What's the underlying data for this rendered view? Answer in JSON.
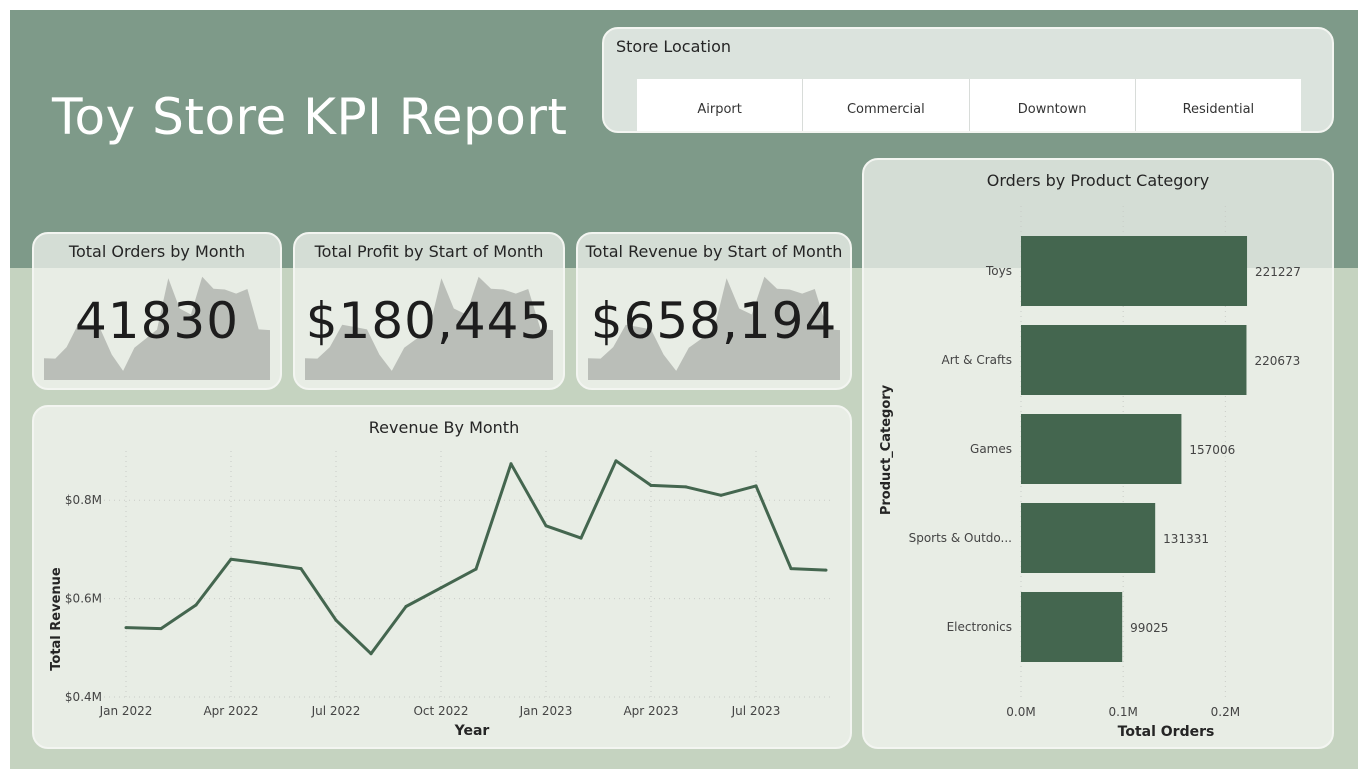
{
  "title": "Toy Store KPI Report",
  "slicer": {
    "title": "Store Location",
    "options": [
      "Airport",
      "Commercial",
      "Downtown",
      "Residential"
    ]
  },
  "kpis": [
    {
      "title": "Total Orders by Month",
      "value": "41830"
    },
    {
      "title": "Total Profit by Start of Month",
      "value": "$180,445"
    },
    {
      "title": "Total Revenue by Start of Month",
      "value": "$658,194"
    }
  ],
  "colors": {
    "background": "#c5d3c0",
    "header_band": "#7e9a89",
    "series": "#44664f",
    "sparkline_fill": "#b5b8b2"
  },
  "chart_data": [
    {
      "type": "area",
      "title": "Total Orders by Month",
      "x": [
        "Jan 2022",
        "Feb 2022",
        "Mar 2022",
        "Apr 2022",
        "May 2022",
        "Jun 2022",
        "Jul 2022",
        "Aug 2022",
        "Sep 2022",
        "Oct 2022",
        "Nov 2022",
        "Dec 2022",
        "Jan 2023",
        "Feb 2023",
        "Mar 2023",
        "Apr 2023",
        "May 2023",
        "Jun 2023",
        "Jul 2023",
        "Aug 2023",
        "Sep 2023"
      ],
      "values": [
        0.541,
        0.539,
        0.587,
        0.68,
        0.671,
        0.661,
        0.556,
        0.488,
        0.584,
        0.622,
        0.66,
        0.874,
        0.748,
        0.723,
        0.88,
        0.83,
        0.827,
        0.81,
        0.829,
        0.661,
        0.658
      ]
    },
    {
      "type": "area",
      "title": "Total Profit by Start of Month",
      "x": [
        "Jan 2022",
        "Feb 2022",
        "Mar 2022",
        "Apr 2022",
        "May 2022",
        "Jun 2022",
        "Jul 2022",
        "Aug 2022",
        "Sep 2022",
        "Oct 2022",
        "Nov 2022",
        "Dec 2022",
        "Jan 2023",
        "Feb 2023",
        "Mar 2023",
        "Apr 2023",
        "May 2023",
        "Jun 2023",
        "Jul 2023",
        "Aug 2023",
        "Sep 2023"
      ],
      "values": [
        0.541,
        0.539,
        0.587,
        0.68,
        0.671,
        0.661,
        0.556,
        0.488,
        0.584,
        0.622,
        0.66,
        0.874,
        0.748,
        0.723,
        0.88,
        0.83,
        0.827,
        0.81,
        0.829,
        0.661,
        0.658
      ]
    },
    {
      "type": "area",
      "title": "Total Revenue by Start of Month",
      "x": [
        "Jan 2022",
        "Feb 2022",
        "Mar 2022",
        "Apr 2022",
        "May 2022",
        "Jun 2022",
        "Jul 2022",
        "Aug 2022",
        "Sep 2022",
        "Oct 2022",
        "Nov 2022",
        "Dec 2022",
        "Jan 2023",
        "Feb 2023",
        "Mar 2023",
        "Apr 2023",
        "May 2023",
        "Jun 2023",
        "Jul 2023",
        "Aug 2023",
        "Sep 2023"
      ],
      "values": [
        0.541,
        0.539,
        0.587,
        0.68,
        0.671,
        0.661,
        0.556,
        0.488,
        0.584,
        0.622,
        0.66,
        0.874,
        0.748,
        0.723,
        0.88,
        0.83,
        0.827,
        0.81,
        0.829,
        0.661,
        0.658
      ]
    },
    {
      "type": "line",
      "title": "Revenue By Month",
      "xlabel": "Year",
      "ylabel": "Total Revenue",
      "x": [
        "Jan 2022",
        "Feb 2022",
        "Mar 2022",
        "Apr 2022",
        "May 2022",
        "Jun 2022",
        "Jul 2022",
        "Aug 2022",
        "Sep 2022",
        "Oct 2022",
        "Nov 2022",
        "Dec 2022",
        "Jan 2023",
        "Feb 2023",
        "Mar 2023",
        "Apr 2023",
        "May 2023",
        "Jun 2023",
        "Jul 2023",
        "Aug 2023",
        "Sep 2023"
      ],
      "series": [
        {
          "values": [
            0.541,
            0.539,
            0.587,
            0.68,
            0.671,
            0.661,
            0.556,
            0.488,
            0.584,
            0.622,
            0.66,
            0.874,
            0.748,
            0.723,
            0.88,
            0.83,
            0.827,
            0.81,
            0.829,
            0.661,
            0.658
          ]
        }
      ],
      "xticks": [
        "Jan 2022",
        "Apr 2022",
        "Jul 2022",
        "Oct 2022",
        "Jan 2023",
        "Apr 2023",
        "Jul 2023"
      ],
      "ytick_values": [
        0.4,
        0.6,
        0.8
      ],
      "ytick_labels": [
        "$0.4M",
        "$0.6M",
        "$0.8M"
      ],
      "ylim": [
        0.4,
        0.9
      ],
      "grid": true
    },
    {
      "type": "bar",
      "orientation": "horizontal",
      "title": "Orders by Product Category",
      "xlabel": "Total Orders",
      "ylabel": "Product_Category",
      "categories": [
        "Toys",
        "Art & Crafts",
        "Games",
        "Sports & Outdo...",
        "Electronics"
      ],
      "values": [
        221227,
        220673,
        157006,
        131331,
        99025
      ],
      "xtick_values": [
        0,
        100000,
        200000
      ],
      "xtick_labels": [
        "0.0M",
        "0.1M",
        "0.2M"
      ],
      "xlim": [
        0,
        230000
      ],
      "grid": true
    }
  ]
}
